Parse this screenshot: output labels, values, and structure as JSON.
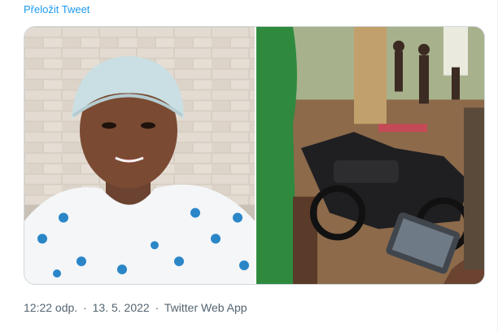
{
  "tweet": {
    "translate_label": "Přeložit Tweet",
    "media": [
      {
        "name": "portrait-photo",
        "icon": "photo-of-smiling-woman-in-knit-cap"
      },
      {
        "name": "scene-photo",
        "icon": "photo-of-motorcycle-and-crowd"
      }
    ],
    "time": "12:22 odp.",
    "separator": "·",
    "date": "13. 5. 2022",
    "source": "Twitter Web App"
  },
  "colors": {
    "link": "#1d9bf0",
    "meta_text": "#536471",
    "border": "#cfd9de"
  }
}
